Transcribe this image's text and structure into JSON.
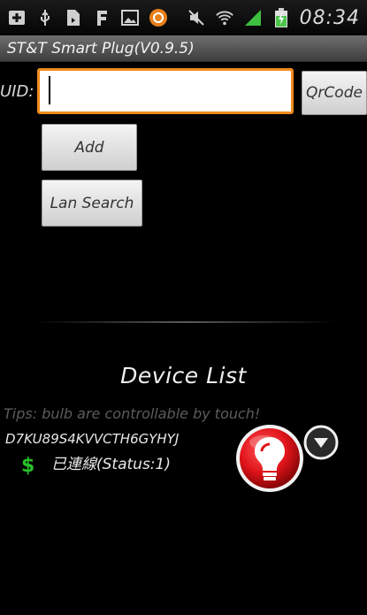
{
  "status_bar": {
    "icons": [
      "add-box-icon",
      "usb-icon",
      "file-sync-icon",
      "facebook-icon",
      "image-icon",
      "orange-circle-icon",
      "mute-icon",
      "wifi-icon",
      "signal-icon",
      "battery-charging-icon"
    ],
    "time": "08:34"
  },
  "title_bar": {
    "title": "ST&T Smart Plug(V0.9.5)"
  },
  "uid": {
    "label": "UID:",
    "value": "",
    "qrcode_label": "QrCode"
  },
  "buttons": {
    "add": "Add",
    "lan_search": "Lan Search"
  },
  "device_list": {
    "title": "Device List",
    "tips": "Tips: bulb are controllable by touch!",
    "devices": [
      {
        "id": "D7KU89S4KVVCTH6GYHYJ",
        "status": "已連線(Status:1)"
      }
    ]
  },
  "colors": {
    "accent_orange": "#f08a1c",
    "bulb_red": "#e0141a",
    "dollar_green": "#27c22a"
  }
}
